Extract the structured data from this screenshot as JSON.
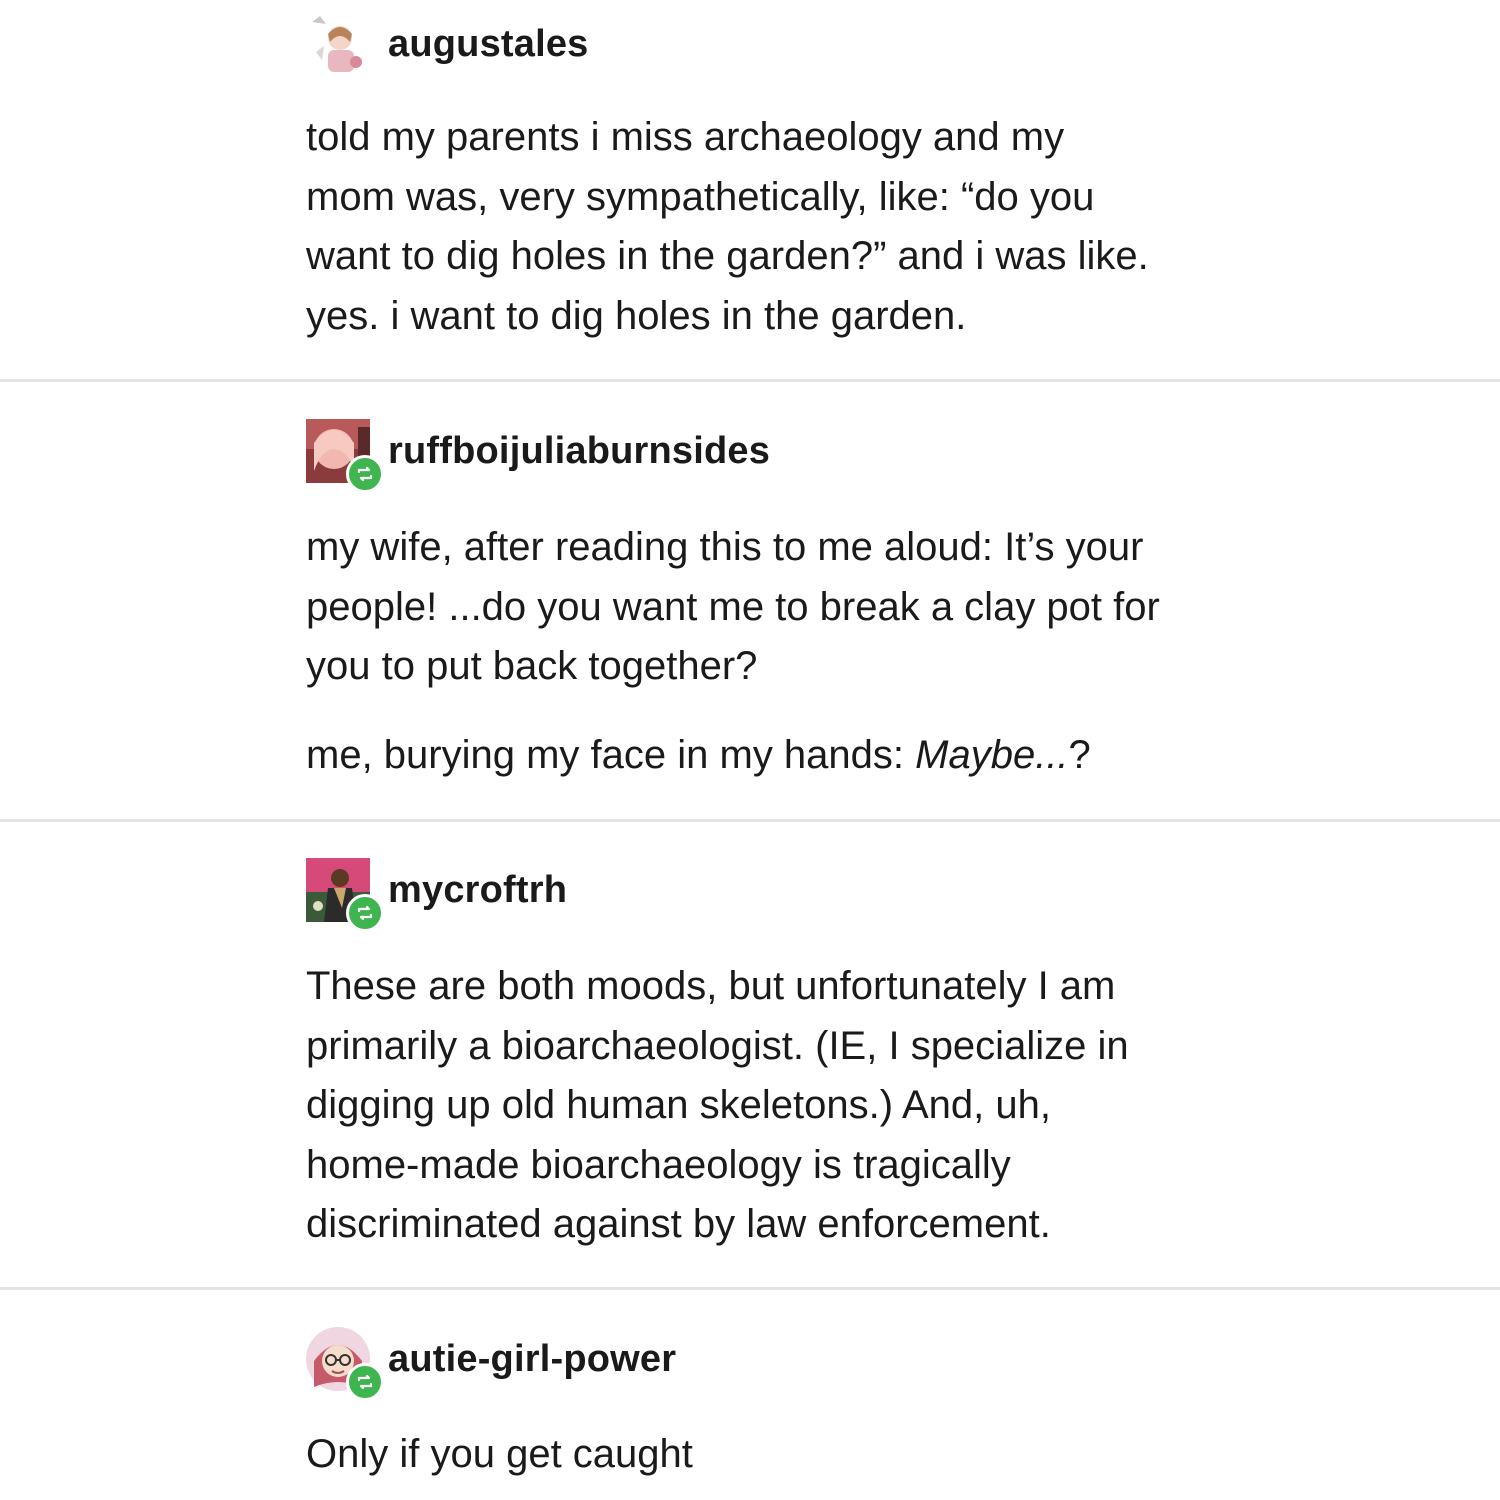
{
  "posts": [
    {
      "username": "augustales",
      "avatar_icon": "illustrated-figure-avatar-icon",
      "reblog": false,
      "lines": [
        "told my parents i miss archaeology and my",
        "mom was, very sympathetically, like: “do you",
        "want to dig holes in the garden?” and i was like.",
        "yes. i want to dig holes in the garden."
      ]
    },
    {
      "username": "ruffboijuliaburnsides",
      "avatar_icon": "pink-hair-avatar-icon",
      "reblog": true,
      "lines": [
        "my wife, after reading this to me aloud: It’s your",
        "people! ...do you want me to break a clay pot for",
        "you to put back together?"
      ],
      "second_paragraph": {
        "prefix": "me, burying my face in my hands: ",
        "emphasis": "Maybe...",
        "suffix": "?"
      }
    },
    {
      "username": "mycroftrh",
      "avatar_icon": "dark-figure-avatar-icon",
      "reblog": true,
      "lines": [
        "These are both moods, but unfortunately I am",
        "primarily a bioarchaeologist.  (IE, I specialize in",
        "digging up old human skeletons.)  And, uh,",
        "home-made bioarchaeology is tragically",
        "discriminated against by law enforcement."
      ]
    },
    {
      "username": "autie-girl-power",
      "avatar_icon": "glasses-girl-avatar-icon",
      "reblog": true,
      "lines": [
        "Only if you get caught"
      ]
    }
  ],
  "colors": {
    "reblog_badge": "#3fb54f",
    "divider": "#e4e4e4",
    "text": "#1a1a1a",
    "background": "#ffffff"
  }
}
